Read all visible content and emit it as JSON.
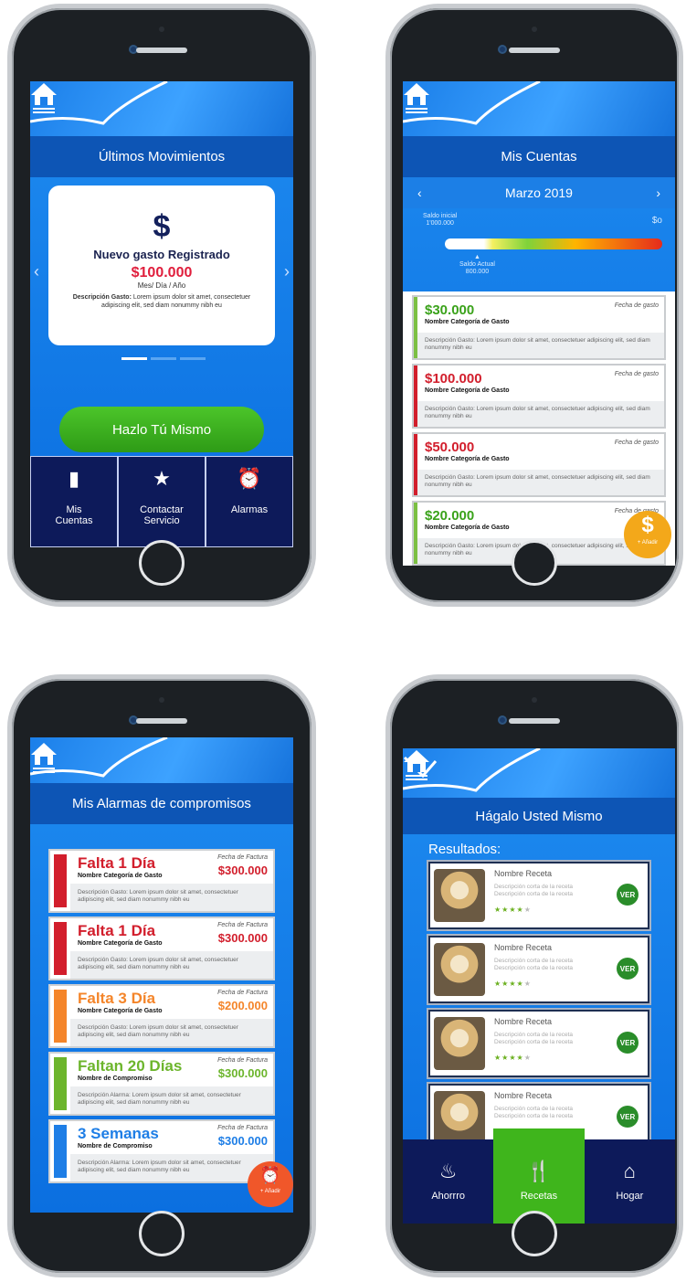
{
  "phone1": {
    "title": "Últimos Movimientos",
    "card": {
      "icon_glyph": "$",
      "heading": "Nuevo gasto Registrado",
      "amount": "$100.000",
      "period": "Mes/ Día / Año",
      "desc_label": "Descripción Gasto:",
      "desc_text": "Lorem ipsum dolor sit amet, consectetuer adipiscing elit, sed diam nonummy nibh eu"
    },
    "cta": "Hazlo Tú Mismo",
    "nav": [
      {
        "icon": "book-icon",
        "label1": "Mis",
        "label2": "Cuentas"
      },
      {
        "icon": "star-icon",
        "label1": "Contactar",
        "label2": "Servicio"
      },
      {
        "icon": "alarm-clock-icon",
        "label1": "Alarmas",
        "label2": ""
      }
    ]
  },
  "phone2": {
    "title": "Mis Cuentas",
    "month": "Marzo 2019",
    "gauge": {
      "start_label": "Saldo inicial",
      "start_value": "1'000.000",
      "end_label": "$o",
      "current_label": "Saldo Actual",
      "current_value": "800.000",
      "level": 0.2
    },
    "expenses": [
      {
        "amount": "$30.000",
        "category": "Nombre Categoría de Gasto",
        "date_label": "Fecha de gasto",
        "desc": "Descripción Gasto: Lorem ipsum dolor sit amet, consectetuer adipiscing elit, sed diam nonummy nibh eu",
        "color": "#7cc043"
      },
      {
        "amount": "$100.000",
        "category": "Nombre Categoría de Gasto",
        "date_label": "Fecha de gasto",
        "desc": "Descripción Gasto: Lorem ipsum dolor sit amet, consectetuer adipiscing elit, sed diam nonummy nibh eu",
        "color": "#d21e2c"
      },
      {
        "amount": "$50.000",
        "category": "Nombre Categoría de Gasto",
        "date_label": "Fecha de gasto",
        "desc": "Descripción Gasto: Lorem ipsum dolor sit amet, consectetuer adipiscing elit, sed diam nonummy nibh eu",
        "color": "#d21e2c"
      },
      {
        "amount": "$20.000",
        "category": "Nombre Categoría de Gasto",
        "date_label": "Fecha de gasto",
        "desc": "Descripción Gasto: Lorem ipsum dolor sit amet, consectetuer adipiscing elit, sed diam nonummy nibh eu",
        "color": "#7cc043"
      }
    ],
    "fab": {
      "glyph": "$",
      "label": "+ Añadir"
    }
  },
  "phone3": {
    "title": "Mis Alarmas de compromisos",
    "alarms": [
      {
        "title": "Falta 1 Día",
        "category": "Nombre Categoría de Gasto",
        "date_label": "Fecha de Factura",
        "amount": "$300.000",
        "desc": "Descripción Gasto: Lorem ipsum dolor sit amet, consectetuer adipiscing elit, sed diam nonummy nibh eu",
        "color": "#d21e2c"
      },
      {
        "title": "Falta 1 Día",
        "category": "Nombre Categoría de Gasto",
        "date_label": "Fecha de Factura",
        "amount": "$300.000",
        "desc": "Descripción Gasto: Lorem ipsum dolor sit amet, consectetuer adipiscing elit, sed diam nonummy nibh eu",
        "color": "#d21e2c"
      },
      {
        "title": "Falta 3 Día",
        "category": "Nombre Categoría de Gasto",
        "date_label": "Fecha de Factura",
        "amount": "$200.000",
        "desc": "Descripción Gasto: Lorem ipsum dolor sit amet, consectetuer adipiscing elit, sed diam nonummy nibh eu",
        "color": "#f4852a"
      },
      {
        "title": "Faltan 20 Días",
        "category": "Nombre de Compromiso",
        "date_label": "Fecha de Factura",
        "amount": "$300.000",
        "desc": "Descripción Alarma: Lorem ipsum dolor sit amet, consectetuer adipiscing elit, sed diam nonummy nibh eu",
        "color": "#6cb52c"
      },
      {
        "title": "3 Semanas",
        "category": "Nombre de Compromiso",
        "date_label": "Fecha de Factura",
        "amount": "$300.000",
        "desc": "Descripción Alarma: Lorem ipsum dolor sit amet, consectetuer adipiscing elit, sed diam nonummy nibh eu",
        "color": "#1e7ee6"
      }
    ],
    "fab": {
      "label": "+ Añadir"
    }
  },
  "phone4": {
    "title": "Hágalo Usted Mismo",
    "results_label": "Resultados:",
    "recipes": [
      {
        "name": "Nombre Receta",
        "desc1": "Descripción corta de la receta",
        "desc2": "Descripción corta de la receta",
        "rating": 4,
        "button": "VER"
      },
      {
        "name": "Nombre Receta",
        "desc1": "Descripción corta de la receta",
        "desc2": "Descripción corta de la receta",
        "rating": 4,
        "button": "VER"
      },
      {
        "name": "Nombre Receta",
        "desc1": "Descripción corta de la receta",
        "desc2": "Descripción corta de la receta",
        "rating": 4,
        "button": "VER"
      },
      {
        "name": "Nombre Receta",
        "desc1": "Descripción corta de la receta",
        "desc2": "Descripción corta de la receta",
        "rating": 4,
        "button": "VER"
      }
    ],
    "nav": [
      {
        "icon": "piggy-bank-icon",
        "label": "Ahorrro"
      },
      {
        "icon": "fork-knife-icon",
        "label": "Recetas",
        "active": true
      },
      {
        "icon": "home-icon",
        "label": "Hogar"
      }
    ]
  }
}
